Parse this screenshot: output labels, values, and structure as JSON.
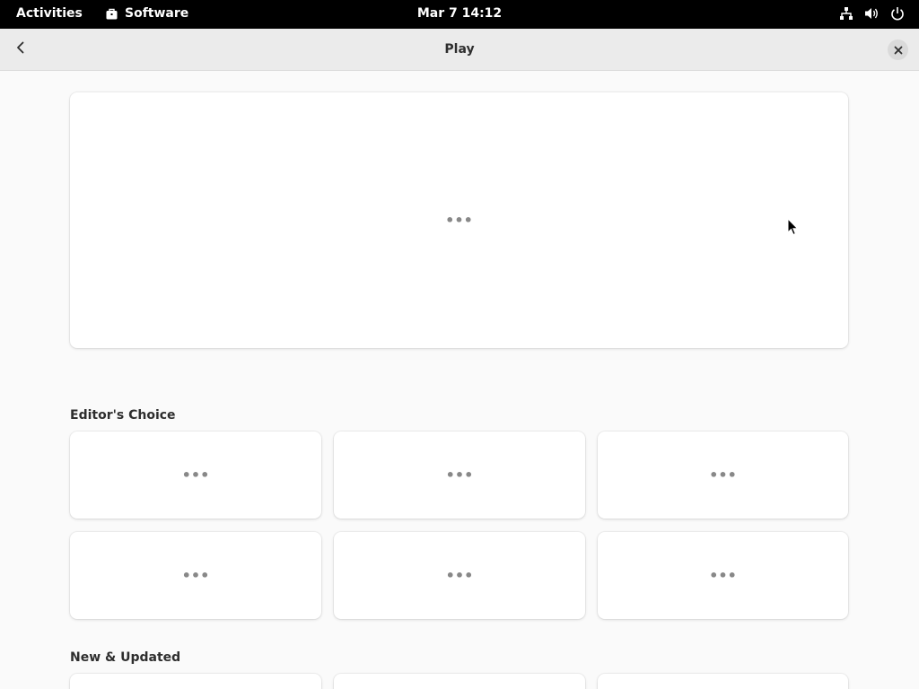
{
  "topbar": {
    "activities": "Activities",
    "app_name": "Software",
    "clock": "Mar 7  14:12",
    "icons": [
      "network-icon",
      "volume-icon",
      "power-icon"
    ]
  },
  "header": {
    "back_icon": "chevron-left-icon",
    "title": "Play",
    "close_icon": "close-icon"
  },
  "featured": {
    "loading": "•••"
  },
  "sections": {
    "editors_choice": {
      "title": "Editor's Choice",
      "tiles": [
        "•••",
        "•••",
        "•••",
        "•••",
        "•••",
        "•••"
      ]
    },
    "new_updated": {
      "title": "New & Updated"
    }
  },
  "colors": {
    "topbar_bg": "#000000",
    "header_bg": "#ebebeb",
    "content_bg": "#fafafa",
    "card_bg": "#ffffff"
  }
}
